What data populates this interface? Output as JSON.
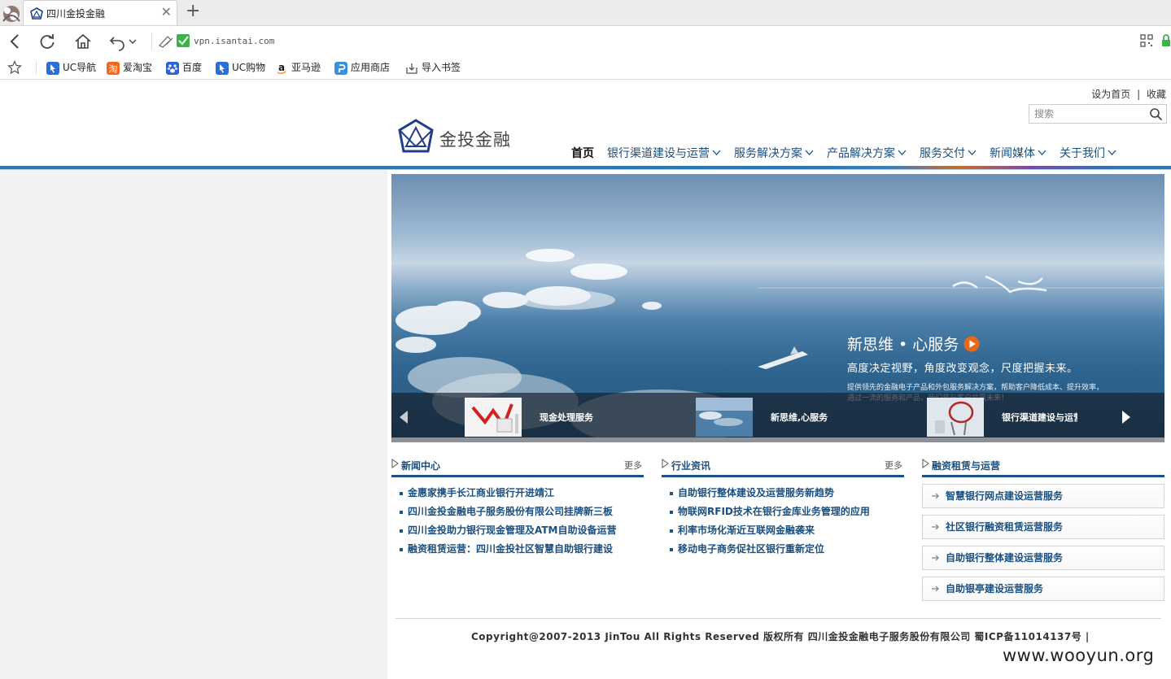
{
  "browser": {
    "tab_title": "四川金投金融",
    "address": "vpn.isantai.com",
    "bookmarks": [
      "UC导航",
      "爱淘宝",
      "百度",
      "UC购物",
      "亚马逊",
      "应用商店",
      "导入书签"
    ]
  },
  "site": {
    "top_links": [
      "设为首页",
      "|",
      "收藏"
    ],
    "search_placeholder": "搜索",
    "logo_text": "金投金融",
    "nav": [
      "首页",
      "银行渠道建设与运营",
      "服务解决方案",
      "产品解决方案",
      "服务交付",
      "新闻媒体",
      "关于我们"
    ]
  },
  "banner": {
    "title": "新思维 • 心服务",
    "subtitle": "高度决定视野，角度改变观念，尺度把握未来。",
    "desc": "提供领先的金融电子产品和外包服务解决方案，帮助客户降低成本、提升效率，通过一流的服务和产品，我们将与客户共赢未来！",
    "thumbs": [
      "现金处理服务",
      "新思维,心服务",
      "银行渠道建设与运营"
    ]
  },
  "news": {
    "title": "新闻中心",
    "more": "更多",
    "items": [
      "金惠家携手长江商业银行开进靖江",
      "四川金投金融电子服务股份有限公司挂牌新三板",
      "四川金投助力银行现金管理及ATM自助设备运营",
      "融资租赁运营：四川金投社区智慧自助银行建设"
    ]
  },
  "industry": {
    "title": "行业资讯",
    "more": "更多",
    "items": [
      "自助银行整体建设及运营服务新趋势",
      "物联网RFID技术在银行金库业务管理的应用",
      "利率市场化渐近互联网金融袭来",
      "移动电子商务促社区银行重新定位"
    ]
  },
  "leasing": {
    "title": "融资租赁与运营",
    "items": [
      "智慧银行网点建设运营服务",
      "社区银行融资租赁运营服务",
      "自助银行整体建设运营服务",
      "自助银亭建设运营服务"
    ]
  },
  "footer": {
    "copyright": "Copyright@2007-2013 JinTou All Rights Reserved 版权所有 四川金投金融电子服务股份有限公司 蜀ICP备11014137号 |"
  },
  "watermark": "www.wooyun.org"
}
